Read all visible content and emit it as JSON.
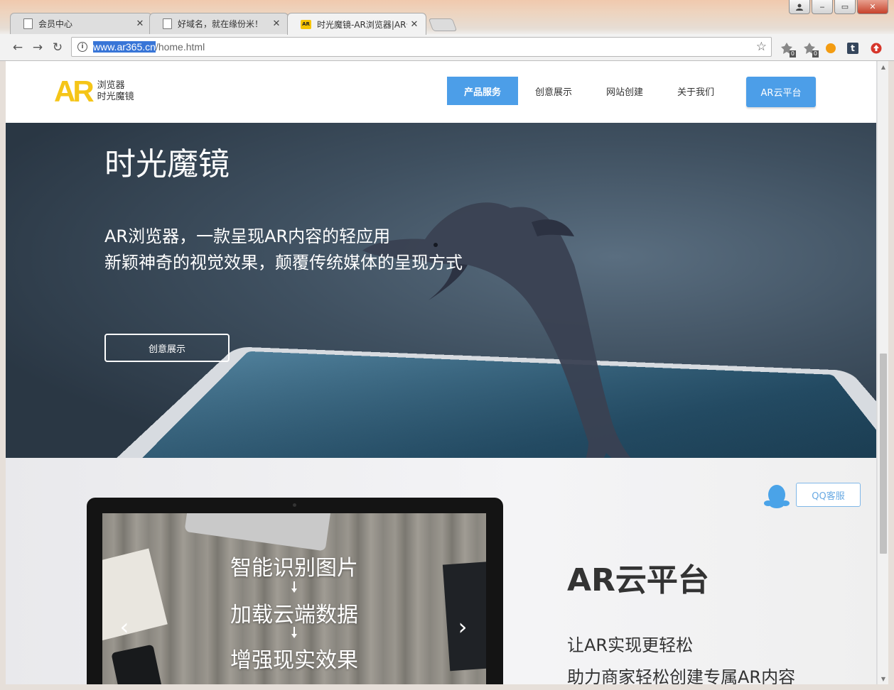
{
  "browser": {
    "tabs": [
      {
        "title": "会员中心"
      },
      {
        "title": "好域名，就在缘份米！"
      },
      {
        "title": "时光魔镜-AR浏览器|AR云平台"
      }
    ],
    "url_selected": "www.ar365.cn",
    "url_rest": "/home.html",
    "window_controls": {
      "minimize": "‒",
      "maximize": "▭",
      "close": "✕"
    },
    "extension_badges": [
      "0",
      "0"
    ]
  },
  "site": {
    "logo": {
      "mark": "AR",
      "line1": "浏览器",
      "line2": "时光魔镜"
    },
    "nav": [
      {
        "label": "产品服务",
        "active": true
      },
      {
        "label": "创意展示",
        "active": false
      },
      {
        "label": "网站创建",
        "active": false
      },
      {
        "label": "关于我们",
        "active": false
      }
    ],
    "cloud_button": "AR云平台",
    "hero": {
      "title": "时光魔镜",
      "line1": "AR浏览器，一款呈现AR内容的轻应用",
      "line2": "新颖神奇的视觉效果，颠覆传统媒体的呈现方式",
      "button": "创意展示"
    },
    "cloud_section": {
      "slides": [
        "智能识别图片",
        "加载云端数据",
        "增强现实效果"
      ],
      "qq_button": "QQ客服",
      "title": "AR云平台",
      "line1": "让AR实现更轻松",
      "line2": "助力商家轻松创建专属AR内容"
    }
  },
  "colors": {
    "accent": "#4c9ee8",
    "logo_yellow": "#f5c518",
    "qq_blue": "#4aa3e8"
  }
}
